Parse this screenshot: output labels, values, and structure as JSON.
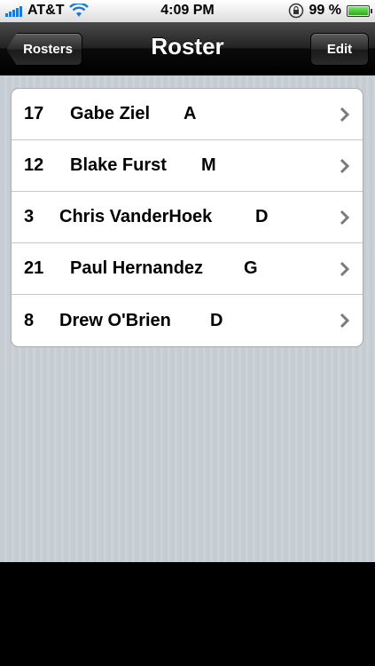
{
  "status_bar": {
    "carrier": "AT&T",
    "time": "4:09 PM",
    "battery": "99 %",
    "icons": [
      "signal-icon",
      "wifi-icon",
      "rotation-lock-icon",
      "battery-icon"
    ]
  },
  "nav": {
    "title": "Roster",
    "back_label": "Rosters",
    "edit_label": "Edit"
  },
  "players": [
    {
      "number": "17",
      "name": "Gabe Ziel",
      "position": "A"
    },
    {
      "number": "12",
      "name": "Blake Furst",
      "position": "M"
    },
    {
      "number": "3",
      "name": "Chris VanderHoek",
      "position": "D"
    },
    {
      "number": "21",
      "name": "Paul Hernandez",
      "position": "G"
    },
    {
      "number": "8",
      "name": "Drew O'Brien",
      "position": "D"
    }
  ],
  "colors": {
    "background_stripes": "#c5ccd4",
    "nav_bar": "#1a1a1a",
    "signal_blue": "#1b78d6",
    "battery_green": "#2fa81e"
  }
}
